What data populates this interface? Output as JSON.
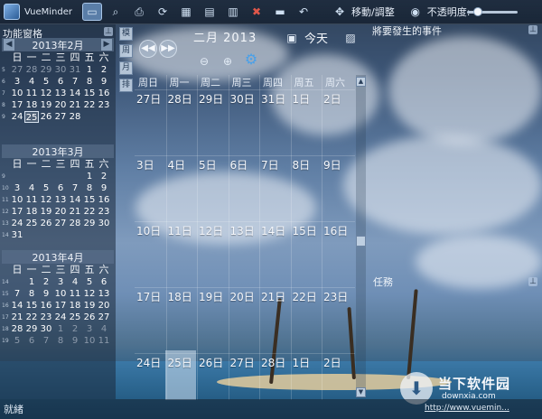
{
  "app": {
    "name": "VueMinder"
  },
  "toolbar": {
    "move_adjust": "移動/調整",
    "opacity_label": "不透明度:",
    "opacity_level": 0.15
  },
  "left_panel": {
    "title": "功能窗格",
    "weekday_headers": [
      "日",
      "一",
      "二",
      "三",
      "四",
      "五",
      "六"
    ],
    "calendars": [
      {
        "title": "2013年2月",
        "weeks": [
          {
            "wk": "5",
            "days": [
              {
                "d": "27",
                "o": true
              },
              {
                "d": "28",
                "o": true
              },
              {
                "d": "29",
                "o": true
              },
              {
                "d": "30",
                "o": true
              },
              {
                "d": "31",
                "o": true
              },
              {
                "d": "1"
              },
              {
                "d": "2"
              }
            ]
          },
          {
            "wk": "6",
            "days": [
              {
                "d": "3"
              },
              {
                "d": "4"
              },
              {
                "d": "5"
              },
              {
                "d": "6"
              },
              {
                "d": "7"
              },
              {
                "d": "8"
              },
              {
                "d": "9"
              }
            ]
          },
          {
            "wk": "7",
            "days": [
              {
                "d": "10"
              },
              {
                "d": "11"
              },
              {
                "d": "12"
              },
              {
                "d": "13"
              },
              {
                "d": "14"
              },
              {
                "d": "15"
              },
              {
                "d": "16"
              }
            ]
          },
          {
            "wk": "8",
            "days": [
              {
                "d": "17"
              },
              {
                "d": "18"
              },
              {
                "d": "19"
              },
              {
                "d": "20"
              },
              {
                "d": "21"
              },
              {
                "d": "22"
              },
              {
                "d": "23"
              }
            ]
          },
          {
            "wk": "9",
            "days": [
              {
                "d": "24"
              },
              {
                "d": "25",
                "today": true
              },
              {
                "d": "26"
              },
              {
                "d": "27"
              },
              {
                "d": "28"
              },
              {
                "d": ""
              },
              {
                "d": ""
              }
            ]
          }
        ]
      },
      {
        "title": "2013年3月",
        "weeks": [
          {
            "wk": "9",
            "days": [
              {
                "d": ""
              },
              {
                "d": ""
              },
              {
                "d": ""
              },
              {
                "d": ""
              },
              {
                "d": ""
              },
              {
                "d": "1"
              },
              {
                "d": "2"
              }
            ]
          },
          {
            "wk": "10",
            "days": [
              {
                "d": "3"
              },
              {
                "d": "4"
              },
              {
                "d": "5"
              },
              {
                "d": "6"
              },
              {
                "d": "7"
              },
              {
                "d": "8"
              },
              {
                "d": "9"
              }
            ]
          },
          {
            "wk": "11",
            "days": [
              {
                "d": "10"
              },
              {
                "d": "11"
              },
              {
                "d": "12"
              },
              {
                "d": "13"
              },
              {
                "d": "14"
              },
              {
                "d": "15"
              },
              {
                "d": "16"
              }
            ]
          },
          {
            "wk": "12",
            "days": [
              {
                "d": "17"
              },
              {
                "d": "18"
              },
              {
                "d": "19"
              },
              {
                "d": "20"
              },
              {
                "d": "21"
              },
              {
                "d": "22"
              },
              {
                "d": "23"
              }
            ]
          },
          {
            "wk": "13",
            "days": [
              {
                "d": "24"
              },
              {
                "d": "25"
              },
              {
                "d": "26"
              },
              {
                "d": "27"
              },
              {
                "d": "28"
              },
              {
                "d": "29"
              },
              {
                "d": "30"
              }
            ]
          },
          {
            "wk": "14",
            "days": [
              {
                "d": "31"
              },
              {
                "d": ""
              },
              {
                "d": ""
              },
              {
                "d": ""
              },
              {
                "d": ""
              },
              {
                "d": ""
              },
              {
                "d": ""
              }
            ]
          }
        ]
      },
      {
        "title": "2013年4月",
        "weeks": [
          {
            "wk": "14",
            "days": [
              {
                "d": ""
              },
              {
                "d": "1"
              },
              {
                "d": "2"
              },
              {
                "d": "3"
              },
              {
                "d": "4"
              },
              {
                "d": "5"
              },
              {
                "d": "6"
              }
            ]
          },
          {
            "wk": "15",
            "days": [
              {
                "d": "7"
              },
              {
                "d": "8"
              },
              {
                "d": "9"
              },
              {
                "d": "10"
              },
              {
                "d": "11"
              },
              {
                "d": "12"
              },
              {
                "d": "13"
              }
            ]
          },
          {
            "wk": "16",
            "days": [
              {
                "d": "14"
              },
              {
                "d": "15"
              },
              {
                "d": "16"
              },
              {
                "d": "17"
              },
              {
                "d": "18"
              },
              {
                "d": "19"
              },
              {
                "d": "20"
              }
            ]
          },
          {
            "wk": "17",
            "days": [
              {
                "d": "21"
              },
              {
                "d": "22"
              },
              {
                "d": "23"
              },
              {
                "d": "24"
              },
              {
                "d": "25"
              },
              {
                "d": "26"
              },
              {
                "d": "27"
              }
            ]
          },
          {
            "wk": "18",
            "days": [
              {
                "d": "28"
              },
              {
                "d": "29"
              },
              {
                "d": "30"
              },
              {
                "d": "1",
                "o": true
              },
              {
                "d": "2",
                "o": true
              },
              {
                "d": "3",
                "o": true
              },
              {
                "d": "4",
                "o": true
              }
            ]
          },
          {
            "wk": "19",
            "days": [
              {
                "d": "5",
                "o": true
              },
              {
                "d": "6",
                "o": true
              },
              {
                "d": "7",
                "o": true
              },
              {
                "d": "8",
                "o": true
              },
              {
                "d": "9",
                "o": true
              },
              {
                "d": "10",
                "o": true
              },
              {
                "d": "11",
                "o": true
              }
            ]
          }
        ]
      }
    ]
  },
  "side_tabs": [
    "模",
    "周",
    "月",
    "排"
  ],
  "main": {
    "month_title": "二月 2013",
    "today_label": "今天",
    "day_headers": [
      "周日",
      "周一",
      "周二",
      "周三",
      "周四",
      "周五",
      "周六"
    ],
    "weeks": [
      [
        "27日",
        "28日",
        "29日",
        "30日",
        "31日",
        "1日",
        "2日"
      ],
      [
        "3日",
        "4日",
        "5日",
        "6日",
        "7日",
        "8日",
        "9日"
      ],
      [
        "10日",
        "11日",
        "12日",
        "13日",
        "14日",
        "15日",
        "16日"
      ],
      [
        "17日",
        "18日",
        "19日",
        "20日",
        "21日",
        "22日",
        "23日"
      ],
      [
        "24日",
        "25日",
        "26日",
        "27日",
        "28日",
        "1日",
        "2日"
      ]
    ]
  },
  "right_panel": {
    "upcoming_title": "將要發生的事件",
    "tasks_label": "任務"
  },
  "status": {
    "text": "就緒"
  },
  "watermark": {
    "name": "当下软件园",
    "domain": "downxia.com",
    "url": "http://www.vuemin..."
  }
}
